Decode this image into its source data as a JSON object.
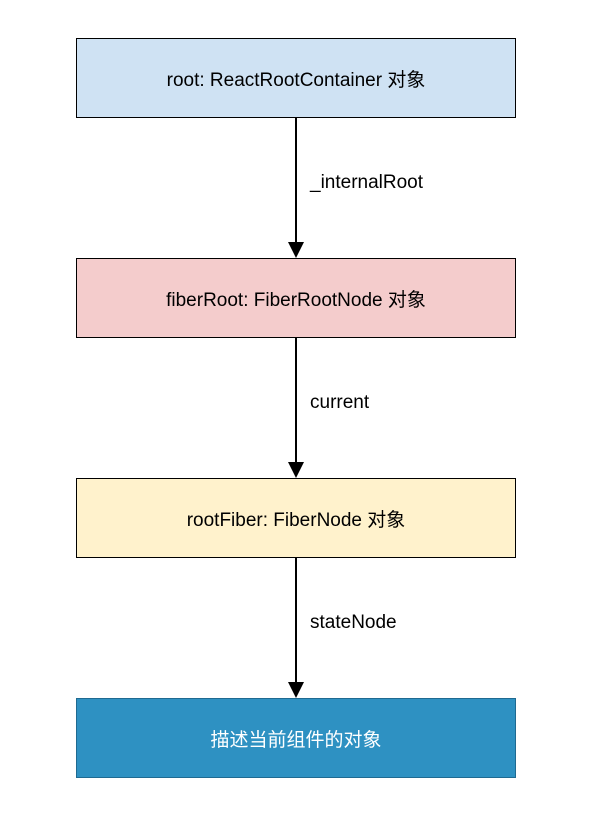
{
  "nodes": {
    "n1": {
      "label": "root: ReactRootContainer 对象",
      "fill": "#CFE2F3",
      "border": "#000000",
      "text": "#000000"
    },
    "n2": {
      "label": "fiberRoot: FiberRootNode 对象",
      "fill": "#F4CCCC",
      "border": "#000000",
      "text": "#000000"
    },
    "n3": {
      "label": "rootFiber: FiberNode 对象",
      "fill": "#FFF2CC",
      "border": "#000000",
      "text": "#000000"
    },
    "n4": {
      "label": "描述当前组件的对象",
      "fill": "#2E91C2",
      "border": "#1F6A91",
      "text": "#FFFFFF"
    }
  },
  "edges": {
    "e1": {
      "from": "n1",
      "to": "n2",
      "label": "_internalRoot"
    },
    "e2": {
      "from": "n2",
      "to": "n3",
      "label": "current"
    },
    "e3": {
      "from": "n3",
      "to": "n4",
      "label": "stateNode"
    }
  },
  "chart_data": {
    "type": "table",
    "description": "Flowchart showing React fiber object relationships",
    "nodes": [
      {
        "id": "n1",
        "label": "root: ReactRootContainer 对象"
      },
      {
        "id": "n2",
        "label": "fiberRoot: FiberRootNode 对象"
      },
      {
        "id": "n3",
        "label": "rootFiber: FiberNode 对象"
      },
      {
        "id": "n4",
        "label": "描述当前组件的对象"
      }
    ],
    "edges": [
      {
        "from": "n1",
        "to": "n2",
        "label": "_internalRoot"
      },
      {
        "from": "n2",
        "to": "n3",
        "label": "current"
      },
      {
        "from": "n3",
        "to": "n4",
        "label": "stateNode"
      }
    ]
  }
}
